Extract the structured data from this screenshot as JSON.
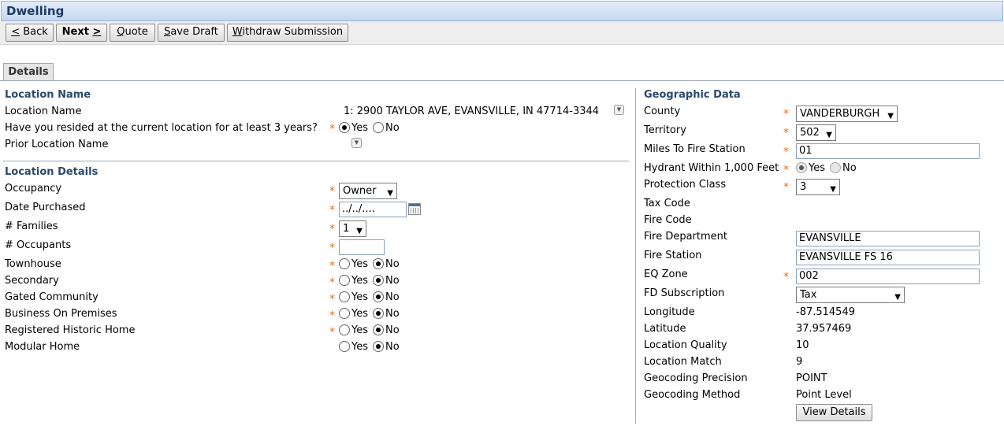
{
  "window": {
    "title": "Dwelling"
  },
  "toolbar": {
    "back": {
      "mn": "<",
      "rest": " Back"
    },
    "next": {
      "pre": "Next ",
      "mn": ">"
    },
    "quote": {
      "mn": "Q",
      "rest": "uote"
    },
    "save": {
      "mn": "S",
      "rest": "ave Draft"
    },
    "withdraw": {
      "mn": "W",
      "rest": "ithdraw Submission"
    }
  },
  "tabs": {
    "details": "Details"
  },
  "location_name": {
    "heading": "Location Name",
    "name_label": "Location Name",
    "name_value": "1: 2900 TAYLOR AVE, EVANSVILLE, IN 47714-3344",
    "resided_label": "Have you resided at the current location for at least 3 years?",
    "resided_yes": "Yes",
    "resided_no": "No",
    "prior_label": "Prior Location Name"
  },
  "location_details": {
    "heading": "Location Details",
    "occupancy_label": "Occupancy",
    "occupancy_value": "Owner",
    "date_label": "Date Purchased",
    "date_value": "../../....",
    "families_label": "# Families",
    "families_value": "1",
    "occupants_label": "# Occupants",
    "occupants_value": "",
    "townhouse_label": "Townhouse",
    "secondary_label": "Secondary",
    "gated_label": "Gated Community",
    "business_label": "Business On Premises",
    "historic_label": "Registered Historic Home",
    "modular_label": "Modular Home",
    "yes": "Yes",
    "no": "No"
  },
  "geographic": {
    "heading": "Geographic Data",
    "county_label": "County",
    "county_value": "VANDERBURGH",
    "territory_label": "Territory",
    "territory_value": "502",
    "miles_label": "Miles To Fire Station",
    "miles_value": "01",
    "hydrant_label": "Hydrant Within 1,000 Feet",
    "hydrant_yes": "Yes",
    "hydrant_no": "No",
    "protection_label": "Protection Class",
    "protection_value": "3",
    "tax_label": "Tax Code",
    "fire_code_label": "Fire Code",
    "fire_dept_label": "Fire Department",
    "fire_dept_value": "EVANSVILLE",
    "fire_station_label": "Fire Station",
    "fire_station_value": "EVANSVILLE FS 16",
    "eq_label": "EQ Zone",
    "eq_value": "002",
    "fd_sub_label": "FD Subscription",
    "fd_sub_value": "Tax",
    "longitude_label": "Longitude",
    "longitude_value": "-87.514549",
    "latitude_label": "Latitude",
    "latitude_value": "37.957469",
    "quality_label": "Location Quality",
    "quality_value": "10",
    "match_label": "Location Match",
    "match_value": "9",
    "precision_label": "Geocoding Precision",
    "precision_value": "POINT",
    "method_label": "Geocoding Method",
    "method_value": "Point Level",
    "view_details": "View Details"
  },
  "icons": {
    "dropdown": "chevron-down-icon",
    "calendar": "calendar-icon",
    "required": "asterisk-icon"
  },
  "colors": {
    "title_text": "#1d3a66",
    "section_heading": "#2a4a6b",
    "required": "#e07020"
  },
  "symbols": {
    "required": "*",
    "select_arrow": "▼",
    "dropdown": "▼"
  }
}
